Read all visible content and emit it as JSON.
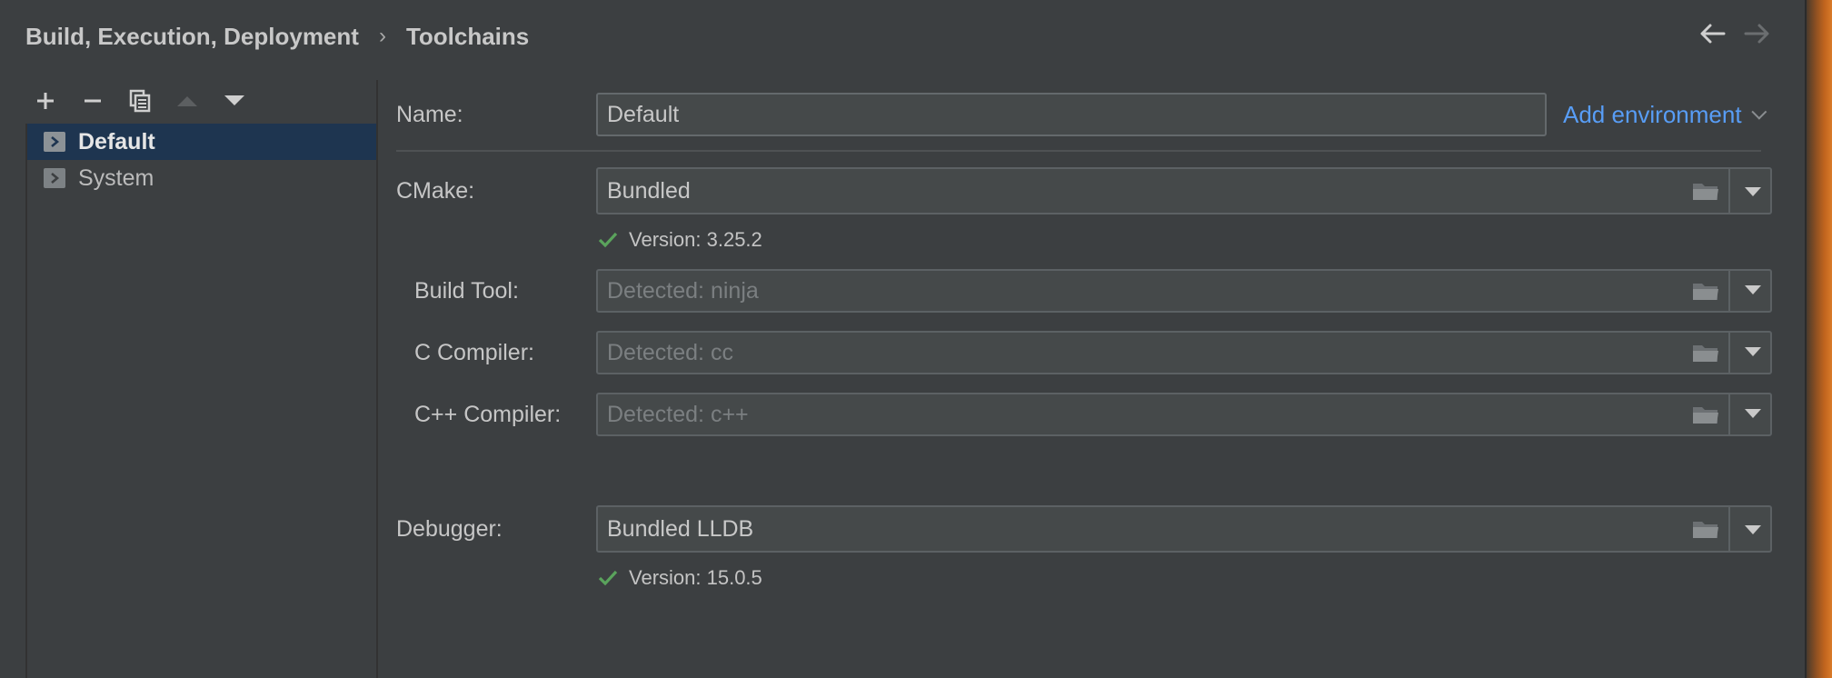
{
  "header": {
    "breadcrumb": [
      "Build, Execution, Deployment",
      "Toolchains"
    ],
    "separator": "›",
    "back_icon": "arrow-left-icon",
    "forward_icon": "arrow-right-icon"
  },
  "toolbar": {
    "buttons": [
      {
        "icon": "plus-icon",
        "enabled": true
      },
      {
        "icon": "minus-icon",
        "enabled": true
      },
      {
        "icon": "copy-icon",
        "enabled": true
      },
      {
        "icon": "move-up-icon",
        "enabled": false
      },
      {
        "icon": "move-down-icon",
        "enabled": true
      }
    ]
  },
  "toolchains": [
    {
      "label": "Default",
      "selected": true
    },
    {
      "label": "System",
      "selected": false
    }
  ],
  "form": {
    "name": {
      "label": "Name:",
      "value": "Default"
    },
    "add_environment": "Add environment",
    "cmake": {
      "label": "CMake:",
      "value": "Bundled",
      "version": "Version: 3.25.2"
    },
    "build_tool": {
      "label": "Build Tool:",
      "placeholder": "Detected: ninja"
    },
    "c_compiler": {
      "label": "C Compiler:",
      "placeholder": "Detected: cc"
    },
    "cpp_compiler": {
      "label": "C++ Compiler:",
      "placeholder": "Detected: c++"
    },
    "debugger": {
      "label": "Debugger:",
      "value": "Bundled LLDB",
      "version": "Version: 15.0.5"
    }
  },
  "colors": {
    "background": "#3c3f41",
    "selection": "#1e3550",
    "link": "#589df6",
    "check": "#5aa35c"
  }
}
